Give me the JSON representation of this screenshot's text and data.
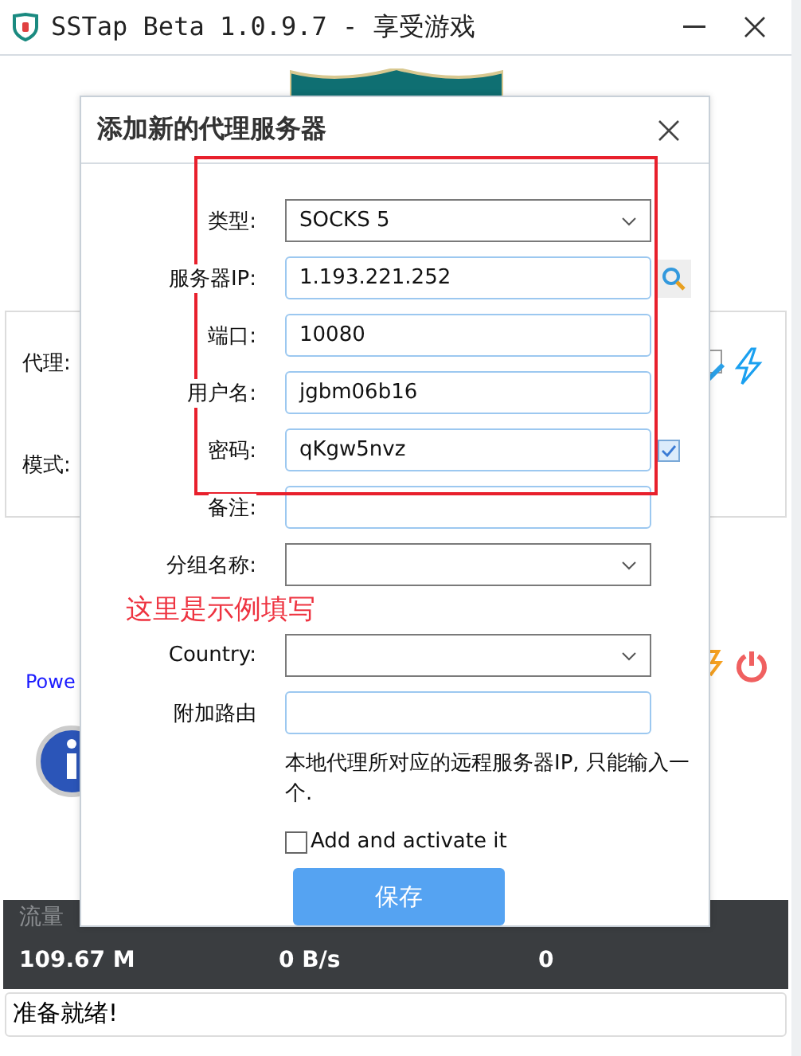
{
  "main_window": {
    "title": "SSTap Beta 1.0.9.7 - 享受游戏",
    "panel": {
      "rows": [
        {
          "label": "代理:"
        },
        {
          "label": "模式:"
        }
      ]
    },
    "power_link": "Powe",
    "stats": {
      "header": "流量",
      "values": [
        "109.67 M",
        "0 B/s",
        "0"
      ]
    },
    "status_bar": "准备就绪!"
  },
  "dialog": {
    "title": "添加新的代理服务器",
    "fields": [
      {
        "kind": "select",
        "label": "类型:",
        "value": "SOCKS 5"
      },
      {
        "kind": "input",
        "label": "服务器IP:",
        "value": "1.193.221.252",
        "search_button": true
      },
      {
        "kind": "input",
        "label": "端口:",
        "value": "10080"
      },
      {
        "kind": "input",
        "label": "用户名:",
        "value": "jgbm06b16"
      },
      {
        "kind": "input",
        "label": "密码:",
        "value": "qKgw5nvz",
        "show_checkbox": {
          "checked": true
        }
      },
      {
        "kind": "input",
        "label": "备注:"
      },
      {
        "kind": "select",
        "label": "分组名称:"
      },
      {
        "kind": "select",
        "label": "Country:"
      },
      {
        "kind": "input",
        "label": "附加路由"
      }
    ],
    "hint": "本地代理所对应的远程服务器IP, 只能输入一个.",
    "activate": {
      "label": "Add and activate it",
      "checked": false
    },
    "save_button": "保存"
  },
  "annotation": {
    "text": "这里是示例填写"
  }
}
